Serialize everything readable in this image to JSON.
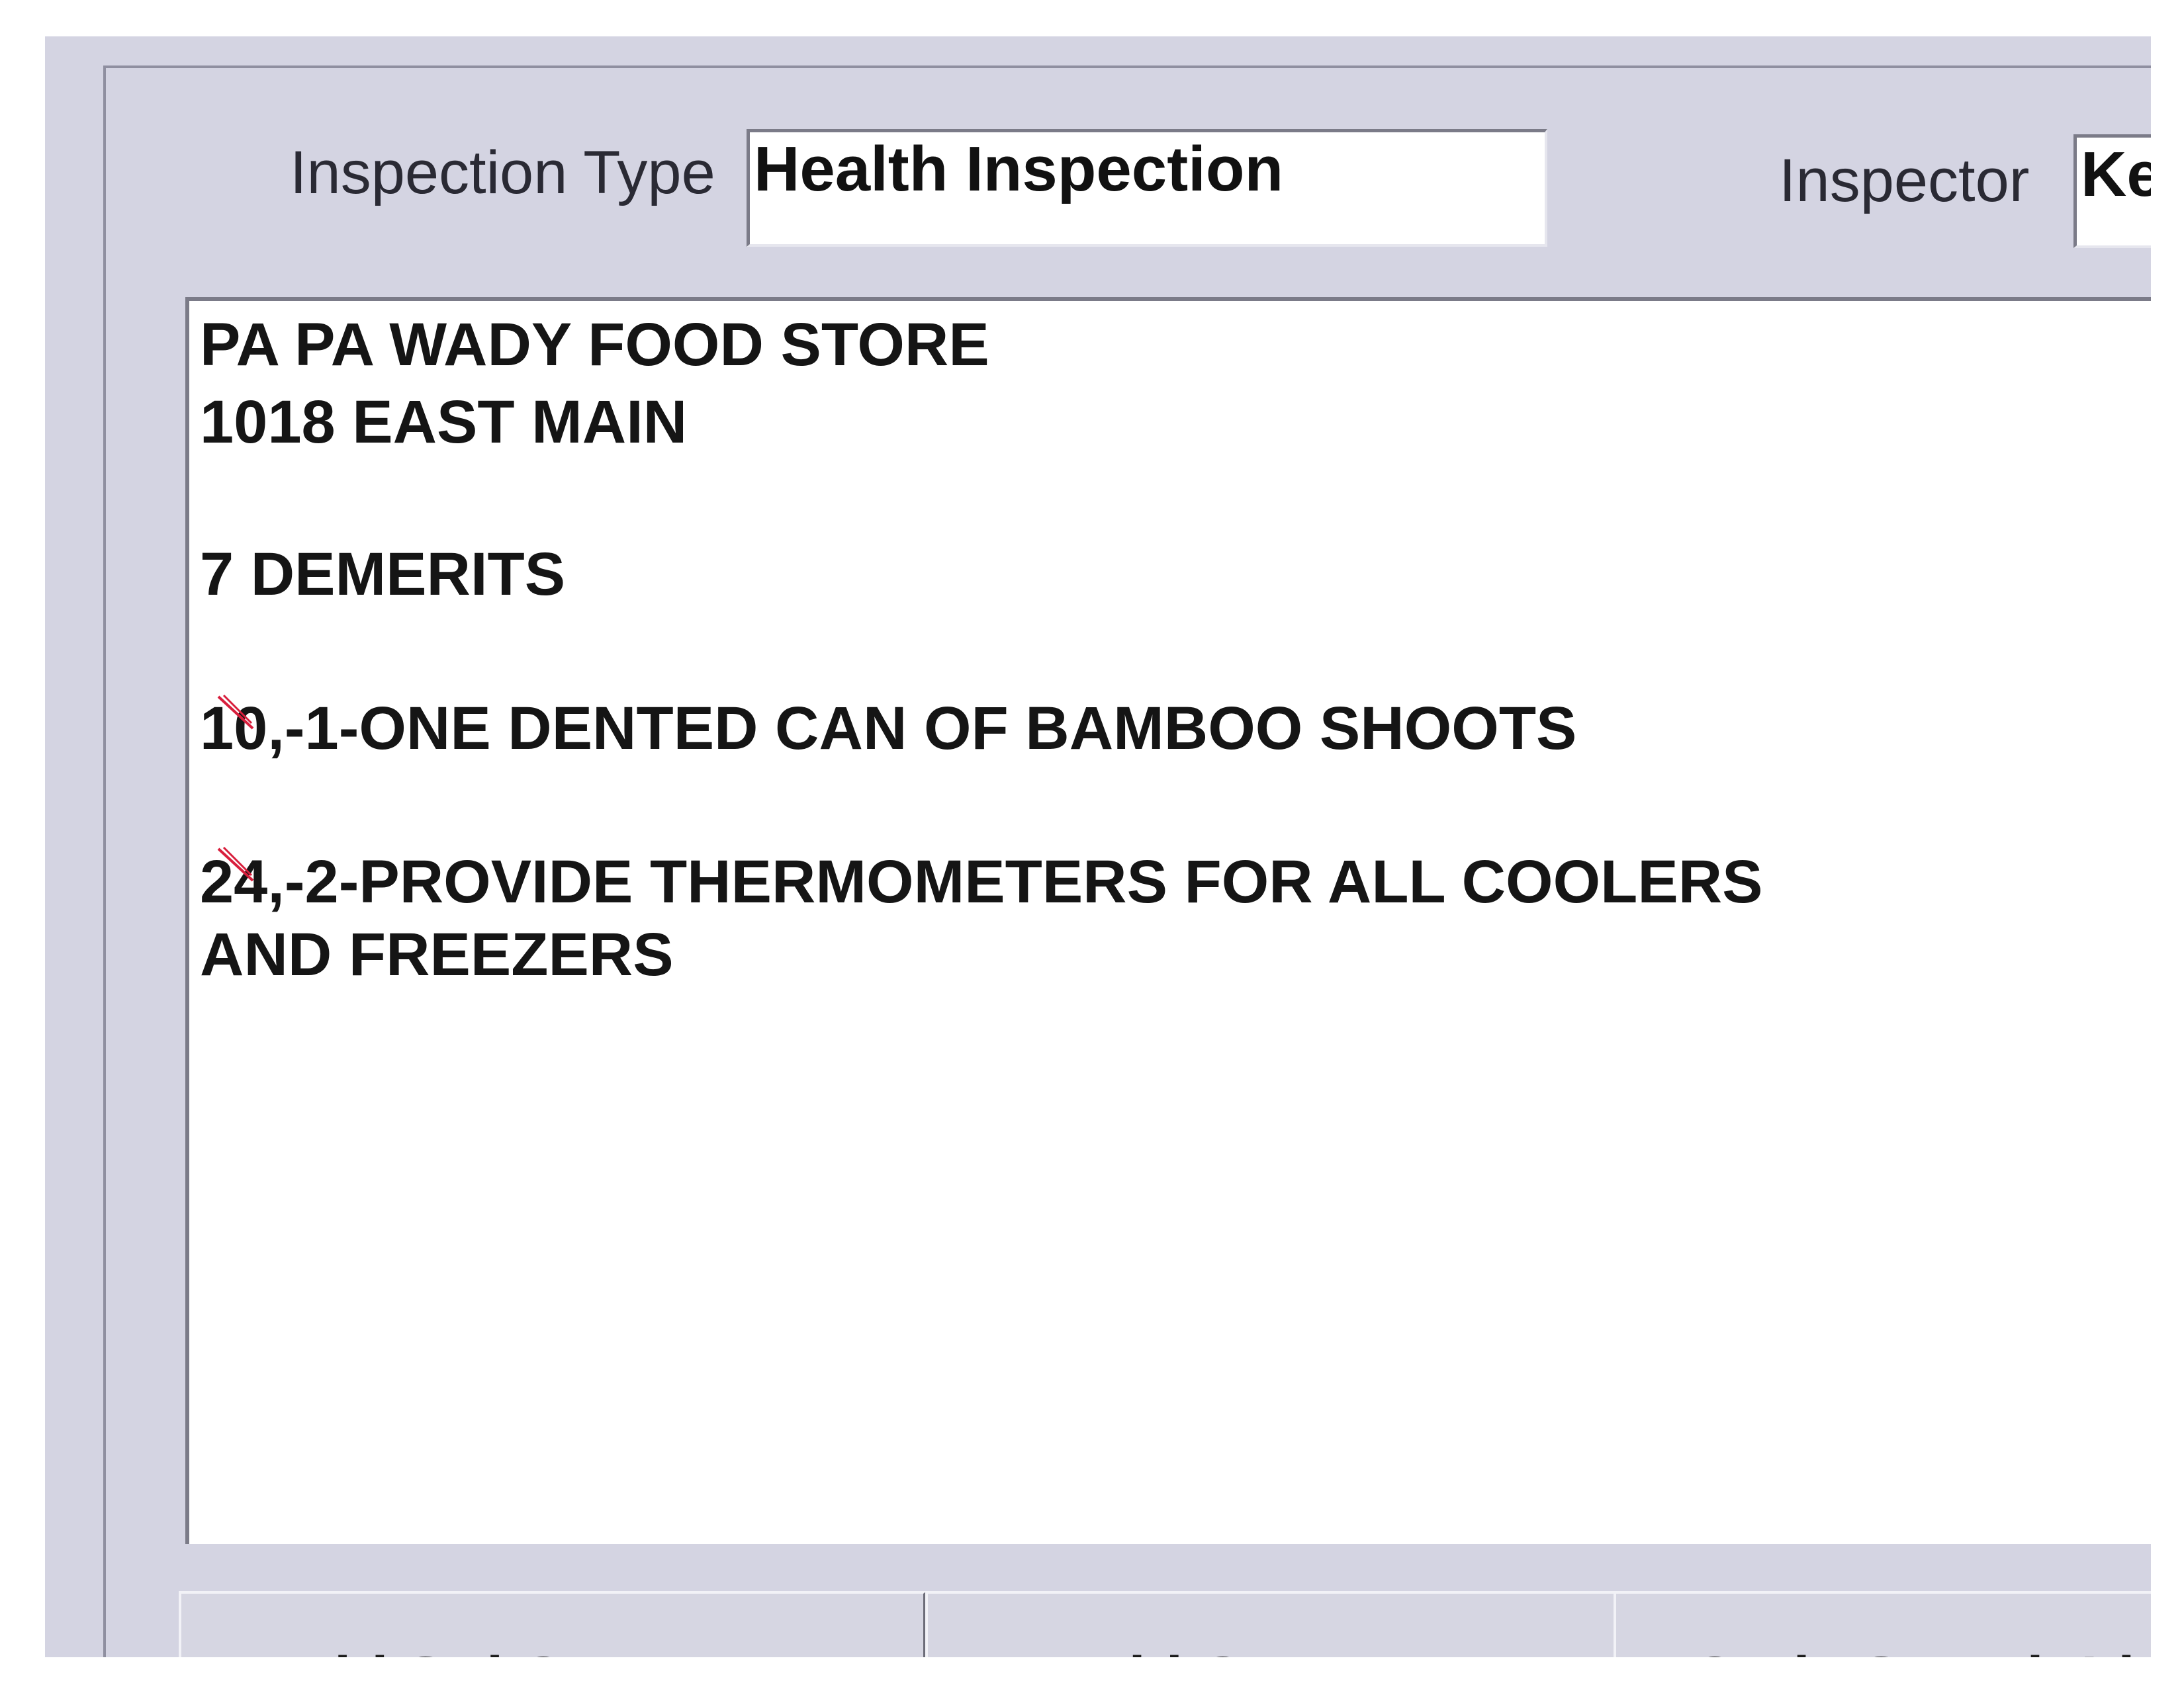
{
  "inspection_type": {
    "label": "Inspection Type",
    "value": "Health Inspection"
  },
  "inspector": {
    "label": "Inspector",
    "value": "Ke"
  },
  "comments": {
    "lines": [
      "PA PA WADY FOOD STORE",
      "1018 EAST MAIN",
      "7 DEMERITS",
      "10,-1-ONE DENTED CAN OF BAMBOO SHOOTS",
      "24,-2-PROVIDE THERMOMETERS FOR ALL COOLERS",
      "AND FREEZERS"
    ]
  },
  "buttons": {
    "add_std_pre": "Add ",
    "add_std_key": "S",
    "add_std_post": "td Comments",
    "add_comment_key": "A",
    "add_comment_post": "dd Comment",
    "code_search": "Code Search Li"
  },
  "colors": {
    "window_bg": "#d4d4e2",
    "field_bg": "#ffffff",
    "strike_mark": "#d81e3c"
  }
}
